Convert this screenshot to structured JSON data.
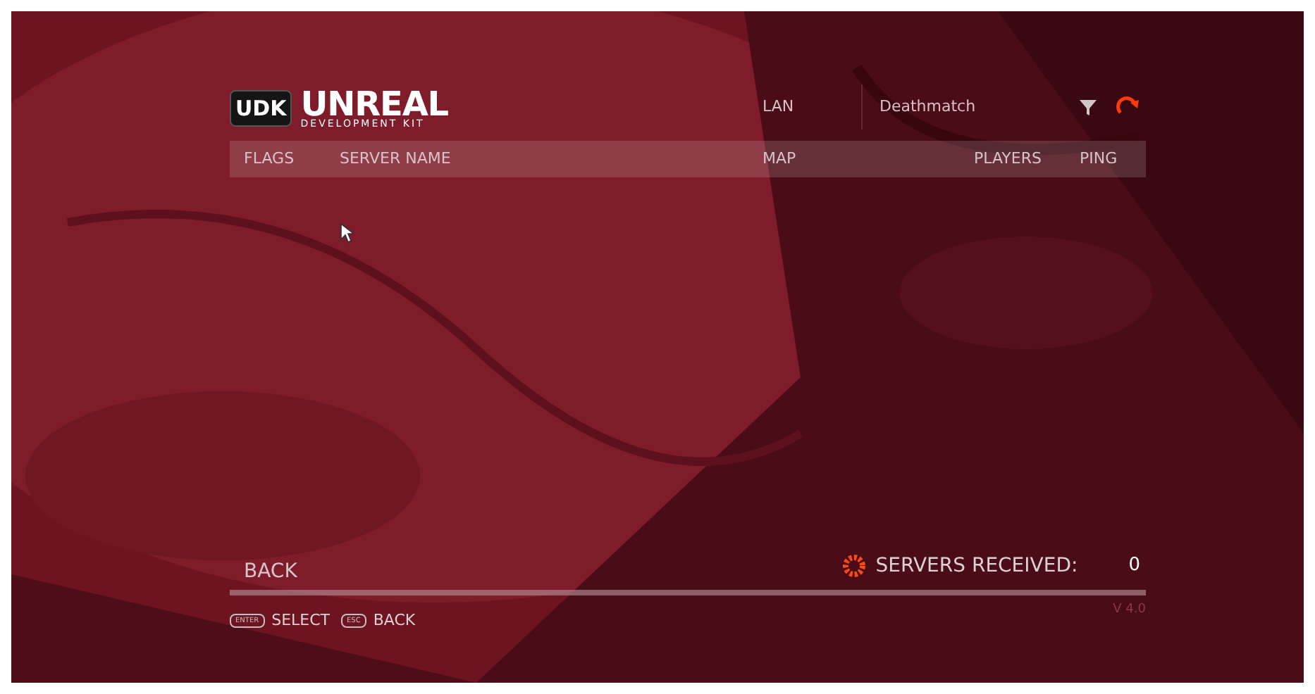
{
  "logo": {
    "badge": "UDK",
    "title": "UNREAL",
    "subtitle": "DEVELOPMENT KIT"
  },
  "filters": [
    {
      "label": "LAN"
    },
    {
      "label": "Deathmatch"
    }
  ],
  "table": {
    "columns": [
      "FLAGS",
      "SERVER NAME",
      "MAP",
      "PLAYERS",
      "PING"
    ]
  },
  "back_button": "BACK",
  "status": {
    "label": "SERVERS RECEIVED:",
    "count": "0"
  },
  "version": "V 4.0",
  "hints": [
    {
      "key": "ENTER",
      "action": "SELECT"
    },
    {
      "key": "ESC",
      "action": "BACK"
    }
  ]
}
